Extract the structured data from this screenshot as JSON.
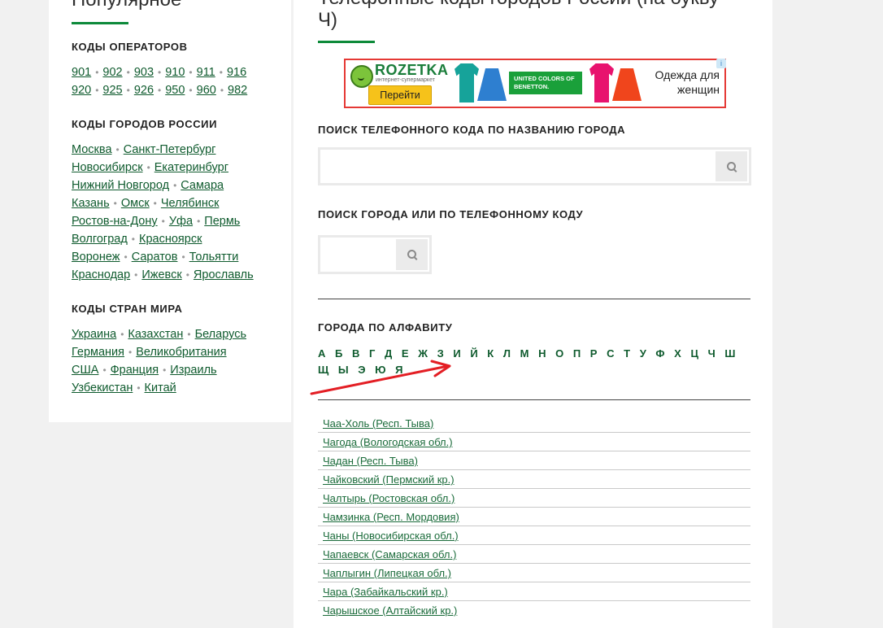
{
  "sidebar": {
    "title": "Популярное",
    "operators": {
      "heading": "КОДЫ ОПЕРАТОРОВ",
      "row1": [
        "901",
        "902",
        "903",
        "910",
        "911",
        "916"
      ],
      "row2": [
        "920",
        "925",
        "926",
        "950",
        "960",
        "982"
      ]
    },
    "russia": {
      "heading": "КОДЫ ГОРОДОВ РОССИИ",
      "rows": [
        [
          "Москва",
          "Санкт-Петербург"
        ],
        [
          "Новосибирск",
          "Екатеринбург"
        ],
        [
          "Нижний Новгород",
          "Самара"
        ],
        [
          "Казань",
          "Омск",
          "Челябинск"
        ],
        [
          "Ростов-на-Дону",
          "Уфа",
          "Пермь"
        ],
        [
          "Волгоград",
          "Красноярск"
        ],
        [
          "Воронеж",
          "Саратов",
          "Тольятти"
        ],
        [
          "Краснодар",
          "Ижевск",
          "Ярославль"
        ]
      ]
    },
    "countries": {
      "heading": "КОДЫ СТРАН МИРА",
      "rows": [
        [
          "Украина",
          "Казахстан",
          "Беларусь"
        ],
        [
          "Германия",
          "Великобритания"
        ],
        [
          "США",
          "Франция",
          "Израиль"
        ],
        [
          "Узбекистан",
          "Китай"
        ]
      ]
    }
  },
  "main": {
    "title_line1": "Телефонные коды городов России (на букву",
    "title_line2": "Ч)",
    "ad": {
      "brand": "ROZETKA",
      "subtitle": "интернет-супермаркет",
      "button": "Перейти",
      "benetton": "UNITED COLORS OF BENETTON.",
      "text": "Одежда для женщин",
      "info": "i"
    },
    "search_city": {
      "label": "ПОИСК ТЕЛЕФОННОГО КОДА ПО НАЗВАНИЮ ГОРОДА",
      "value": ""
    },
    "search_code": {
      "label": "ПОИСК ГОРОДА ИЛИ ПО ТЕЛЕФОННОМУ КОДУ",
      "value": ""
    },
    "alphabet_heading": "ГОРОДА ПО АЛФАВИТУ",
    "letters": [
      "А",
      "Б",
      "В",
      "Г",
      "Д",
      "Е",
      "Ж",
      "З",
      "И",
      "Й",
      "К",
      "Л",
      "М",
      "Н",
      "О",
      "П",
      "Р",
      "С",
      "Т",
      "У",
      "Ф",
      "Х",
      "Ц",
      "Ч",
      "Ш",
      "Щ",
      "Ы",
      "Э",
      "Ю",
      "Я"
    ],
    "cities": [
      "Чаа-Холь (Респ. Тыва)",
      "Чагода (Вологодская обл.)",
      "Чадан (Респ. Тыва)",
      "Чайковский (Пермский кр.)",
      "Чалтырь (Ростовская обл.)",
      "Чамзинка (Респ. Мордовия)",
      "Чаны (Новосибирская обл.)",
      "Чапаевск (Самарская обл.)",
      "Чаплыгин (Липецкая обл.)",
      "Чара (Забайкальский кр.)",
      "Чарышское (Алтайский кр.)"
    ]
  },
  "colors": {
    "accent_green": "#0d8a3a",
    "link": "#0f5b2e",
    "arrow": "#e31e24"
  }
}
